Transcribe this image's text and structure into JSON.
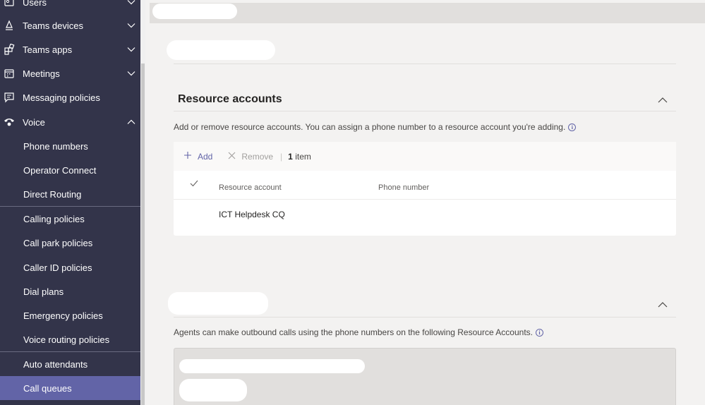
{
  "sidebar": {
    "items": [
      {
        "label": "Users",
        "icon": "users-icon",
        "chevron": "down"
      },
      {
        "label": "Teams devices",
        "icon": "teams-devices-icon",
        "chevron": "down"
      },
      {
        "label": "Teams apps",
        "icon": "teams-apps-icon",
        "chevron": "down"
      },
      {
        "label": "Meetings",
        "icon": "meetings-icon",
        "chevron": "down"
      },
      {
        "label": "Messaging policies",
        "icon": "messaging-icon"
      },
      {
        "label": "Voice",
        "icon": "voice-icon",
        "chevron": "up"
      },
      {
        "label": "Phone numbers"
      },
      {
        "label": "Operator Connect"
      },
      {
        "label": "Direct Routing"
      },
      {
        "label": "Calling policies"
      },
      {
        "label": "Call park policies"
      },
      {
        "label": "Caller ID policies"
      },
      {
        "label": "Dial plans"
      },
      {
        "label": "Emergency policies"
      },
      {
        "label": "Voice routing policies"
      },
      {
        "label": "Auto attendants"
      },
      {
        "label": "Call queues",
        "active": true
      }
    ],
    "background": "#33344a",
    "active_color": "#6264a7"
  },
  "resource_accounts": {
    "title": "Resource accounts",
    "description": "Add or remove resource accounts. You can assign a phone number to a resource account you're adding.",
    "toolbar": {
      "add_label": "Add",
      "remove_label": "Remove",
      "separator": "|",
      "count_number": "1",
      "count_suffix": "item"
    },
    "columns": [
      "Resource account",
      "Phone number"
    ],
    "rows": [
      {
        "resource_account": "ICT Helpdesk CQ",
        "phone_number": ""
      }
    ]
  },
  "outbound": {
    "description": "Agents can make outbound calls using the phone numbers on the following Resource Accounts."
  },
  "colors": {
    "accent": "#6264a7",
    "page_background": "#f3f2f1",
    "card_background": "#ffffff"
  }
}
